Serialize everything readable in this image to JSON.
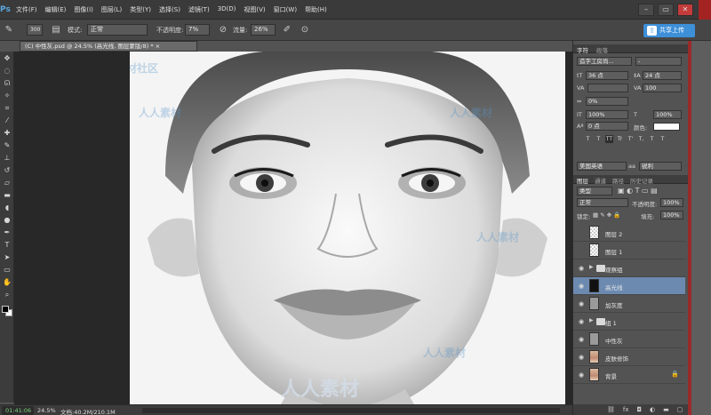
{
  "menubar": {
    "logo": "Ps",
    "items": [
      "文件(F)",
      "编辑(E)",
      "图像(I)",
      "图层(L)",
      "类型(Y)",
      "选择(S)",
      "滤镜(T)",
      "3D(D)",
      "视图(V)",
      "窗口(W)",
      "帮助(H)"
    ],
    "window_controls": [
      "–",
      "▭",
      "✕"
    ]
  },
  "options": {
    "brush_size": "300",
    "mode_label": "模式:",
    "mode_value": "正常",
    "opacity_label": "不透明度:",
    "opacity_value": "7%",
    "flow_label": "流量:",
    "flow_value": "26%",
    "share_label": "共享上传"
  },
  "document": {
    "tab_title": "(C) 中性灰.psd @ 24.5% (高光线, 图层蒙版/8) * ×"
  },
  "status": {
    "time": "01:41:06",
    "zoom": "24.5%",
    "doc_size": "文档:40.2M/210.1M"
  },
  "character_panel": {
    "tabs": [
      "字符",
      "段落"
    ],
    "font_family": "造字工房尚...",
    "font_style": "-",
    "font_size": "36 点",
    "leading": "24 点",
    "kerning": "",
    "tracking": "100",
    "scale_percent": "0%",
    "vertical_scale": "100%",
    "horizontal_scale": "100%",
    "baseline": "0 点",
    "color_label": "颜色:",
    "style_buttons": [
      "T",
      "T",
      "TT",
      "Tr",
      "T'",
      "T,",
      "T",
      "T"
    ],
    "language": "美国英语",
    "antialias_icon": "aa",
    "antialias": "锐利"
  },
  "layers_panel": {
    "tabs": [
      "图层",
      "通道",
      "路径",
      "历史记录"
    ],
    "filter_kind": "类型",
    "blend_mode": "正常",
    "opacity_label": "不透明度:",
    "opacity_value": "100%",
    "lock_label": "锁定:",
    "fill_label": "填充:",
    "fill_value": "100%",
    "layers": [
      {
        "name": "图层 2",
        "visible": false,
        "thumb": "trans",
        "folder": false,
        "selected": false,
        "lock": false
      },
      {
        "name": "图层 1",
        "visible": false,
        "thumb": "trans",
        "folder": false,
        "selected": false,
        "lock": false
      },
      {
        "name": "观察组",
        "visible": true,
        "thumb": "",
        "folder": true,
        "selected": false,
        "lock": false
      },
      {
        "name": "高光线",
        "visible": true,
        "thumb": "black",
        "folder": false,
        "selected": true,
        "lock": false
      },
      {
        "name": "加灰度",
        "visible": true,
        "thumb": "gray",
        "folder": false,
        "selected": false,
        "lock": false
      },
      {
        "name": "组 1",
        "visible": true,
        "thumb": "",
        "folder": true,
        "selected": false,
        "lock": false
      },
      {
        "name": "中性灰",
        "visible": true,
        "thumb": "gray",
        "folder": false,
        "selected": false,
        "lock": false
      },
      {
        "name": "皮肤修饰",
        "visible": true,
        "thumb": "photo",
        "folder": false,
        "selected": false,
        "lock": false
      },
      {
        "name": "背景",
        "visible": true,
        "thumb": "photo",
        "folder": false,
        "selected": false,
        "lock": true
      }
    ],
    "footer_icons": [
      "link-icon",
      "fx-icon",
      "mask-icon",
      "adjustment-icon",
      "folder-icon",
      "new-layer-icon",
      "trash-icon"
    ]
  },
  "watermark": {
    "text": "人人素材",
    "top_text": "人人素材社区"
  },
  "colors": {
    "accent": "#3d8fd8",
    "selected_layer": "#6c8ab0",
    "border_red": "#9a2a2a"
  }
}
